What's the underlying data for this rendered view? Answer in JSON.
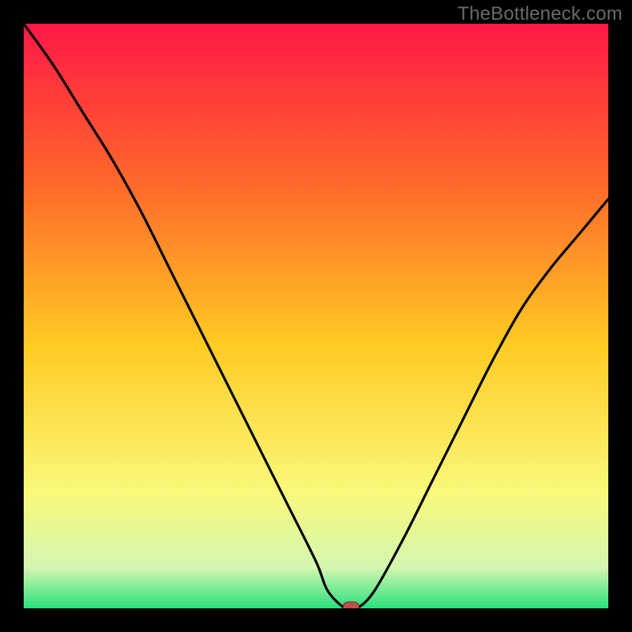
{
  "watermark": "TheBottleneck.com",
  "colors": {
    "frame": "#000000",
    "grad_top": "#ff1846",
    "grad_upper_mid": "#ff6a2a",
    "grad_mid": "#ffcb22",
    "grad_lower_mid": "#f9f87a",
    "grad_near_bottom": "#d4f6b0",
    "grad_bottom": "#2be07e",
    "curve": "#000000",
    "marker_fill": "#c0504d",
    "marker_stroke": "#6b2a28"
  },
  "chart_data": {
    "type": "line",
    "title": "",
    "xlabel": "",
    "ylabel": "",
    "xlim": [
      0,
      100
    ],
    "ylim": [
      0,
      100
    ],
    "series": [
      {
        "name": "bottleneck-curve",
        "x": [
          0,
          5,
          10,
          15,
          20,
          25,
          30,
          35,
          40,
          45,
          50,
          52,
          55,
          57,
          60,
          65,
          70,
          75,
          80,
          85,
          90,
          95,
          100
        ],
        "values": [
          100,
          93,
          85,
          77,
          68,
          58,
          48,
          38,
          28,
          18,
          8,
          3,
          0,
          0,
          3,
          12,
          22,
          32,
          42,
          51,
          58,
          64,
          70
        ]
      }
    ],
    "marker": {
      "x": 56,
      "y": 0
    },
    "grid": false,
    "legend": null
  }
}
